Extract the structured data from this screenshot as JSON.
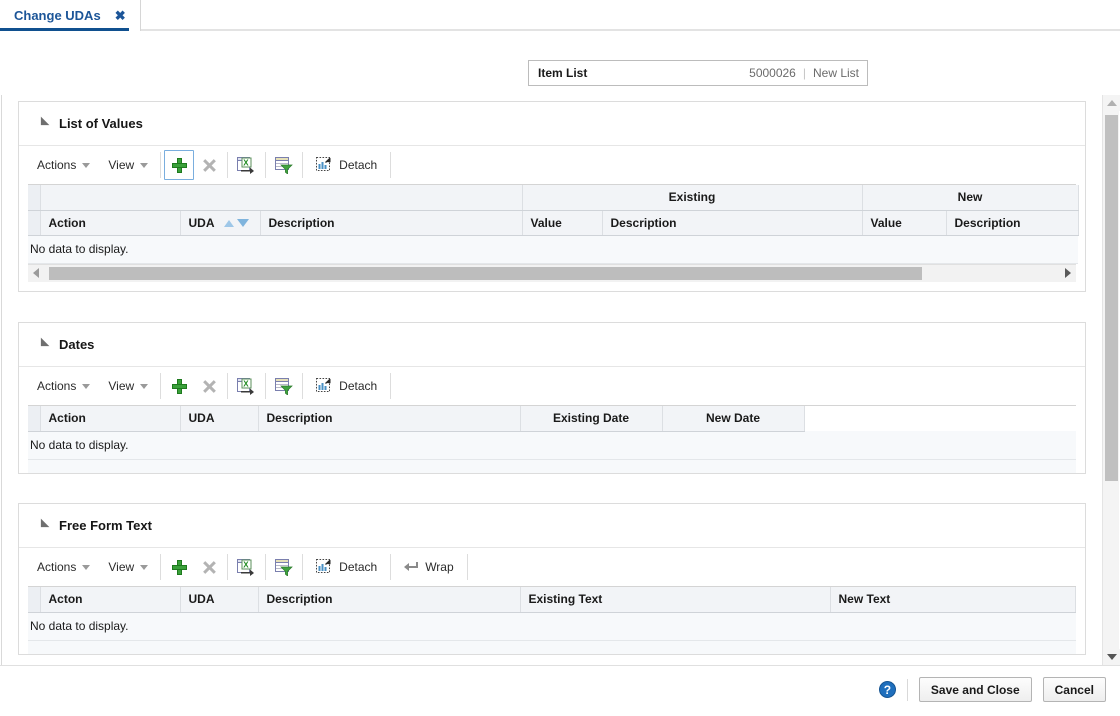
{
  "tab": {
    "label": "Change UDAs",
    "close_glyph": "✖"
  },
  "item_list": {
    "label": "Item List",
    "value": "5000026",
    "separator": "|",
    "new_list_label": "New List"
  },
  "toolbar_common": {
    "actions_label": "Actions",
    "view_label": "View",
    "detach_label": "Detach",
    "wrap_label": "Wrap",
    "add_icon": "plus-icon",
    "delete_icon": "delete-x-icon",
    "export_icon": "export-to-excel-icon",
    "filter_icon": "query-by-example-icon",
    "detach_icon": "detach-icon",
    "wrap_icon": "wrap-icon"
  },
  "sections": [
    {
      "id": "list-of-values",
      "title": "List of Values",
      "add_selected": true,
      "has_wrap": false,
      "has_hscroll": true,
      "group_headers": [
        {
          "label": "",
          "span": 3
        },
        {
          "label": "Existing",
          "span": 2
        },
        {
          "label": "New",
          "span": 2
        }
      ],
      "columns": [
        "Action",
        "UDA",
        "Description",
        "Value",
        "Description",
        "Value",
        "Description"
      ],
      "sort_column": "UDA",
      "no_data_text": "No data to display."
    },
    {
      "id": "dates",
      "title": "Dates",
      "add_selected": false,
      "has_wrap": false,
      "has_hscroll": false,
      "columns": [
        "Action",
        "UDA",
        "Description",
        "Existing Date",
        "New Date"
      ],
      "no_data_text": "No data to display."
    },
    {
      "id": "free-form-text",
      "title": "Free Form Text",
      "add_selected": false,
      "has_wrap": true,
      "has_hscroll": false,
      "columns": [
        "Acton",
        "UDA",
        "Description",
        "Existing Text",
        "New Text"
      ],
      "no_data_text": "No data to display."
    }
  ],
  "footer": {
    "help_glyph": "?",
    "save_and_close_label": "Save and Close",
    "cancel_label": "Cancel"
  },
  "colors": {
    "tab_text": "#1c5598",
    "tab_active_bar": "#10508f",
    "panel_border": "#dcdcdc",
    "header_bg": "#f2f4f7",
    "no_data_bg": "#f7f9fb",
    "add_icon_green": "#3aa03a",
    "help_blue": "#1f6fbd",
    "scroll_thumb": "#bdbdbd"
  }
}
